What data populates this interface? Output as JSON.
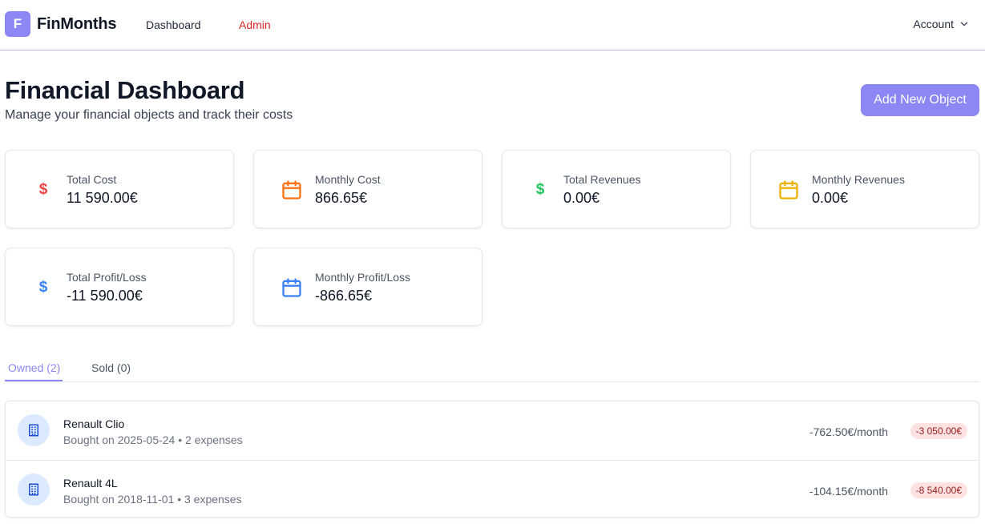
{
  "nav": {
    "logo_letter": "F",
    "brand": "FinMonths",
    "links": [
      "Dashboard",
      "Admin"
    ],
    "account": "Account"
  },
  "header": {
    "title": "Financial Dashboard",
    "subtitle": "Manage your financial objects and track their costs",
    "add_button": "Add New Object"
  },
  "stats": [
    {
      "label": "Total Cost",
      "value": "11 590.00€",
      "icon": "dollar-icon",
      "color": "#ef4444"
    },
    {
      "label": "Monthly Cost",
      "value": "866.65€",
      "icon": "calendar-icon",
      "color": "#f97316"
    },
    {
      "label": "Total Revenues",
      "value": "0.00€",
      "icon": "dollar-icon",
      "color": "#22c55e"
    },
    {
      "label": "Monthly Revenues",
      "value": "0.00€",
      "icon": "calendar-icon",
      "color": "#eab308"
    },
    {
      "label": "Total Profit/Loss",
      "value": "-11 590.00€",
      "icon": "dollar-icon",
      "color": "#3b82f6"
    },
    {
      "label": "Monthly Profit/Loss",
      "value": "-866.65€",
      "icon": "calendar-icon",
      "color": "#3b82f6"
    }
  ],
  "tabs": {
    "owned": "Owned (2)",
    "sold": "Sold (0)"
  },
  "objects": [
    {
      "name": "Renault Clio",
      "meta": "Bought on 2025-05-24 • 2 expenses",
      "monthly": "-762.50€/month",
      "total": "-3 050.00€"
    },
    {
      "name": "Renault 4L",
      "meta": "Bought on 2018-11-01 • 3 expenses",
      "monthly": "-104.15€/month",
      "total": "-8 540.00€"
    }
  ],
  "colors": {
    "accent": "#8b87f5",
    "admin_link": "#dc2626",
    "negative_badge_bg": "#fee2e2",
    "negative_badge_text": "#991b1b"
  }
}
